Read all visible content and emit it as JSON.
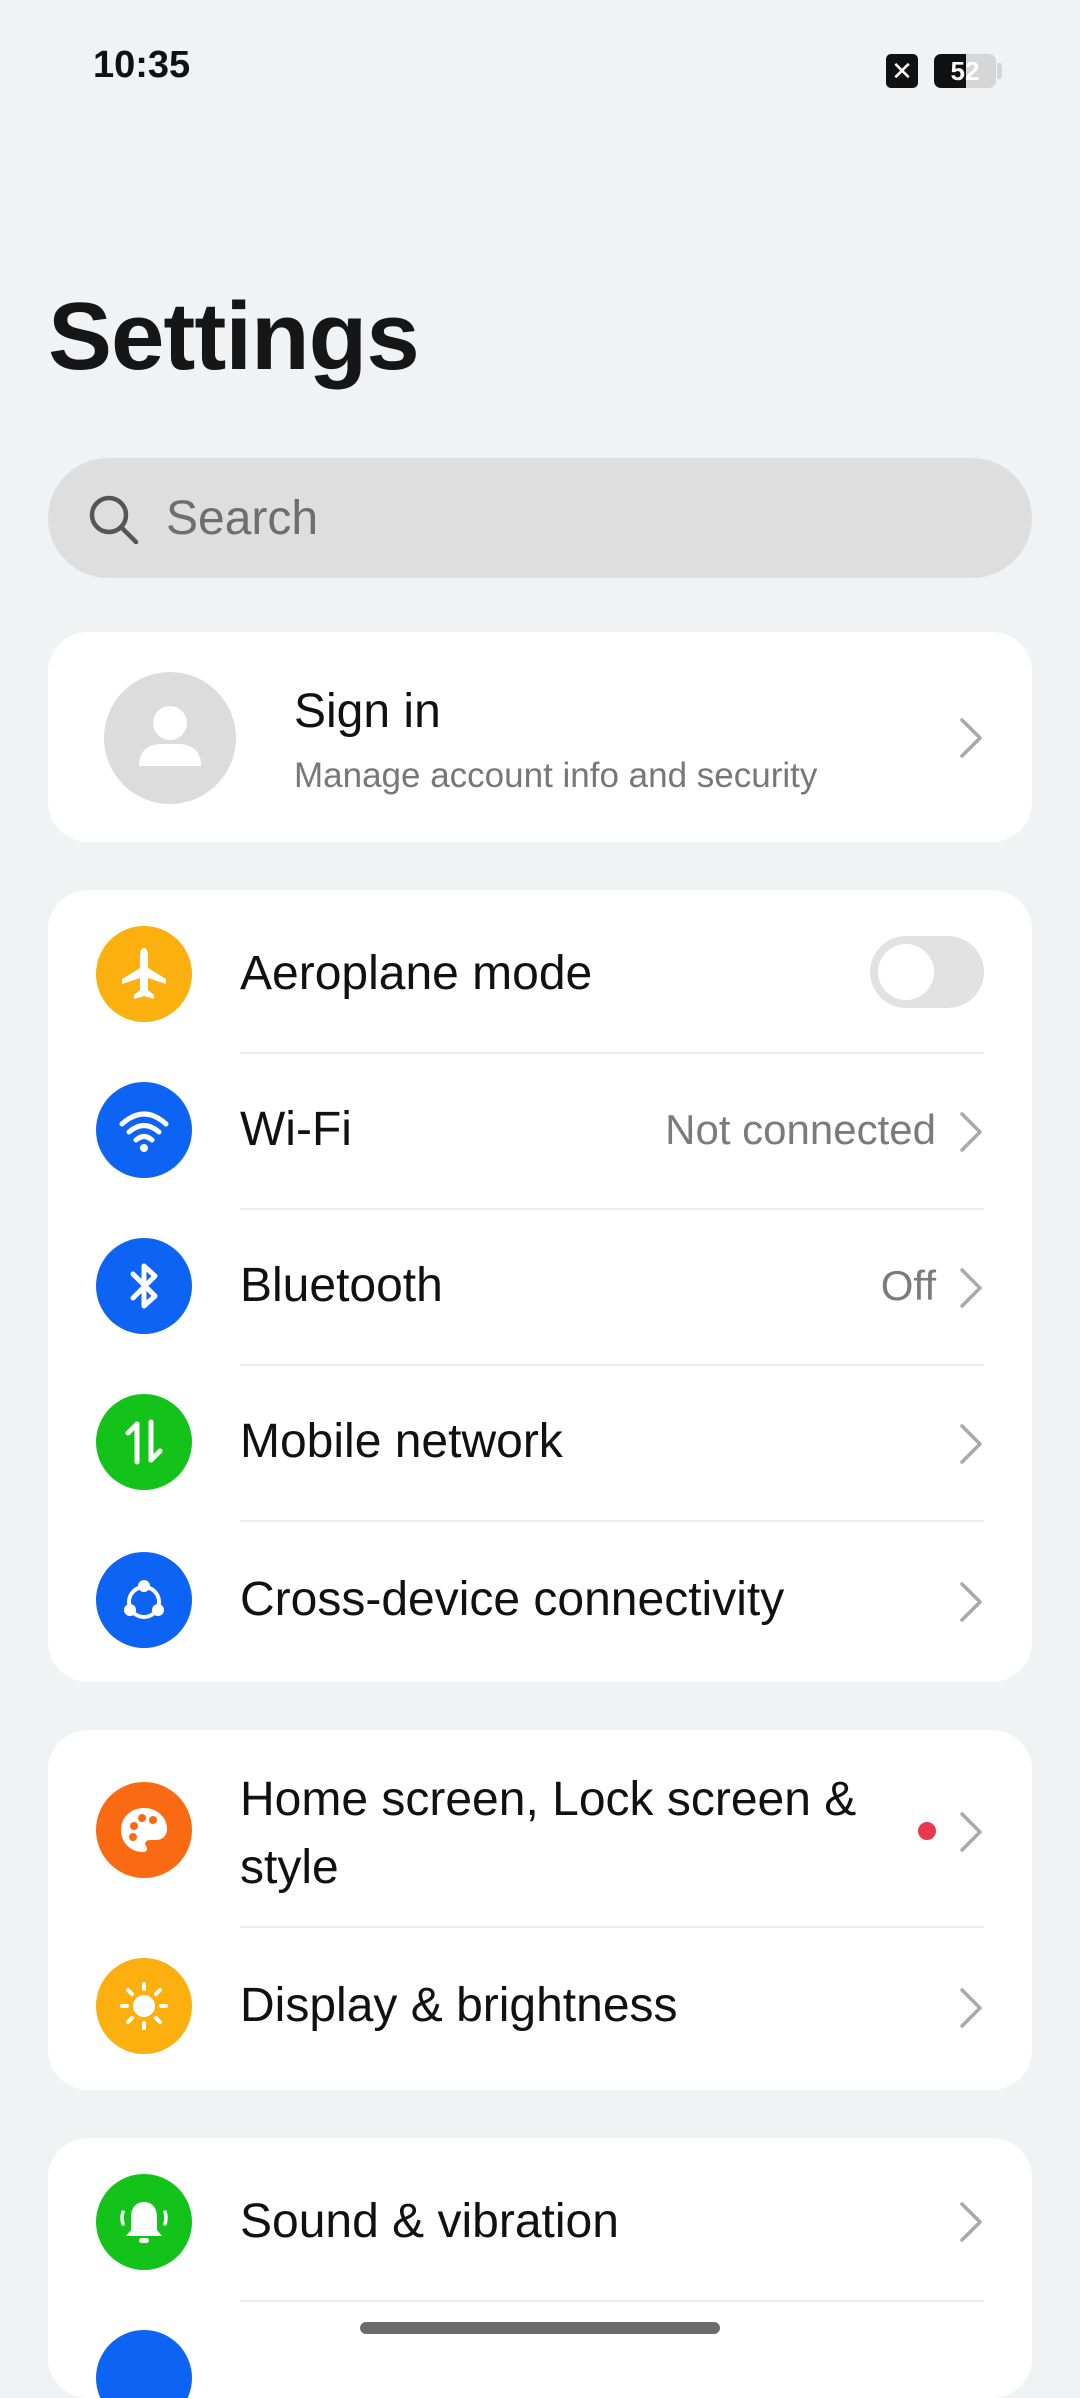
{
  "status": {
    "time": "10:35",
    "battery_level": "52",
    "sim_icon": "sim-error-icon"
  },
  "page": {
    "title": "Settings"
  },
  "search": {
    "placeholder": "Search"
  },
  "account": {
    "title": "Sign in",
    "subtitle": "Manage account info and security"
  },
  "connectivity": {
    "aeroplane": {
      "label": "Aeroplane mode",
      "enabled": false,
      "icon": "aeroplane-icon",
      "color": "#fbb00f"
    },
    "wifi": {
      "label": "Wi-Fi",
      "value": "Not connected",
      "icon": "wifi-icon",
      "color": "#0d63f3"
    },
    "bluetooth": {
      "label": "Bluetooth",
      "value": "Off",
      "icon": "bluetooth-icon",
      "color": "#0d63f3"
    },
    "mobile": {
      "label": "Mobile network",
      "icon": "mobile-data-icon",
      "color": "#14c31a"
    },
    "cross": {
      "label": "Cross-device connectivity",
      "icon": "cross-device-icon",
      "color": "#0d63f3"
    }
  },
  "personalization": {
    "home": {
      "label_line1": "Home screen, Lock screen &",
      "label_line2": "style",
      "icon": "palette-icon",
      "color": "#fa6a12",
      "badge_color": "#e8384f"
    },
    "display": {
      "label": "Display & brightness",
      "icon": "brightness-icon",
      "color": "#fbb00f"
    }
  },
  "sound": {
    "sound": {
      "label": "Sound & vibration",
      "icon": "bell-icon",
      "color": "#14c31a"
    }
  }
}
